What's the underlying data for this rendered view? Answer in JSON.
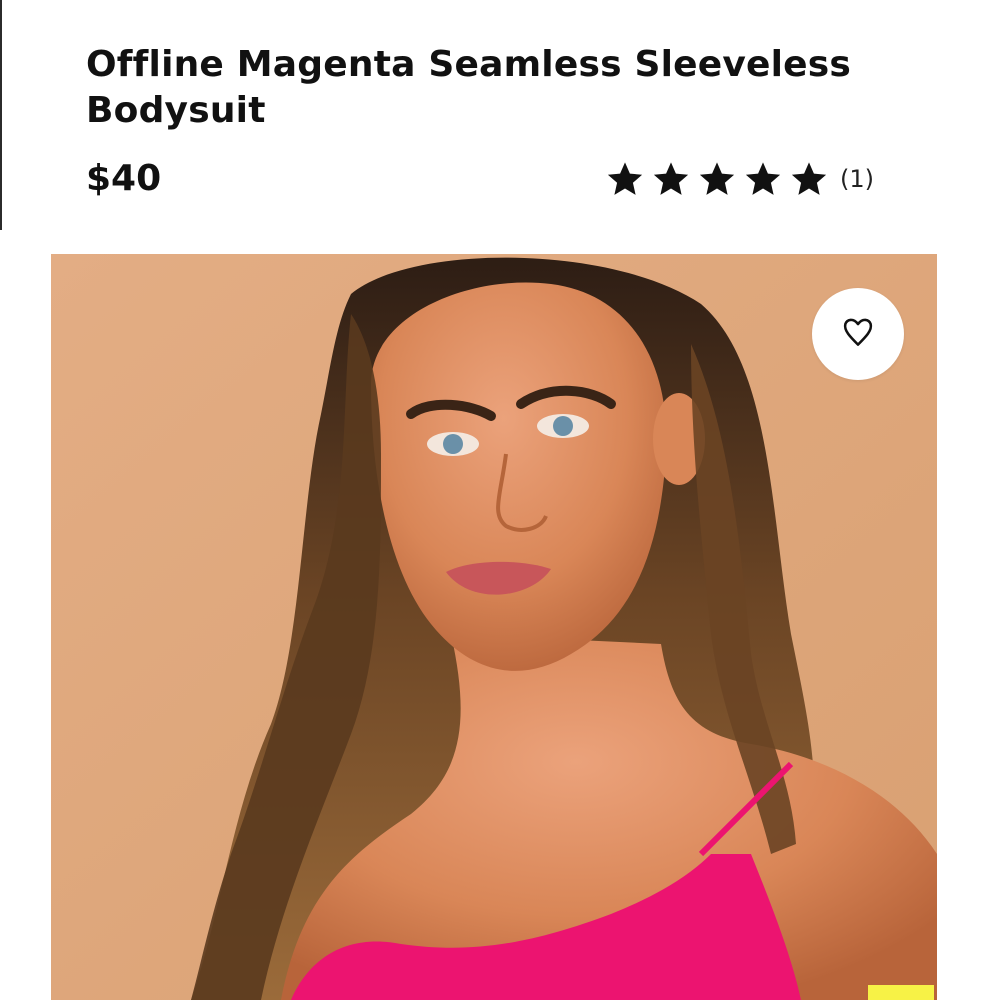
{
  "product": {
    "title": "Offline Magenta Seamless Sleeveless Bodysuit",
    "price": "$40",
    "rating": {
      "stars": 5,
      "max_stars": 5,
      "review_count_label": "(1)",
      "icon": "star-icon"
    }
  },
  "image": {
    "description_icon": "product-photo",
    "background_color": "#dea67b",
    "garment_color": "#ec1470"
  },
  "wishlist": {
    "icon": "heart-outline-icon",
    "button_color": "#ffffff"
  },
  "colors": {
    "text": "#111111",
    "accent_yellow": "#f7f246"
  }
}
